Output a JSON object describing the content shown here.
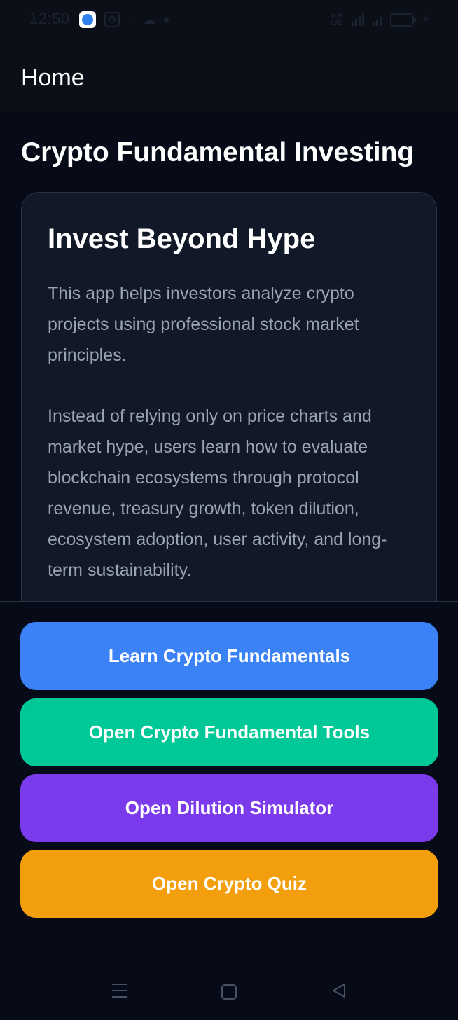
{
  "status_bar": {
    "time": "12:50",
    "volte_top": "VoB",
    "volte_bottom": "LTE"
  },
  "app_bar": {
    "title": "Home"
  },
  "main": {
    "title": "Crypto Fundamental Investing",
    "card": {
      "heading": "Invest Beyond Hype",
      "paragraph_1": "This app helps investors analyze crypto projects using professional stock market principles.",
      "paragraph_2": "Instead of relying only on price charts and market hype, users learn how to evaluate blockchain ecosystems through protocol revenue, treasury growth, token dilution, ecosystem adoption, user activity, and long-term sustainability."
    }
  },
  "actions": {
    "learn_label": "Learn Crypto Fundamentals",
    "tools_label": "Open Crypto Fundamental Tools",
    "dilution_label": "Open Dilution Simulator",
    "quiz_label": "Open Crypto Quiz"
  },
  "colors": {
    "background": "#060b17",
    "card": "#111827",
    "learn_button": "#3b82f6",
    "tools_button": "#00c896",
    "dilution_button": "#7c3aed",
    "quiz_button": "#f29e0d"
  },
  "icons": {
    "nav_menu": "menu-lines-icon",
    "nav_home": "square-home-icon",
    "nav_back": "triangle-back-icon"
  }
}
